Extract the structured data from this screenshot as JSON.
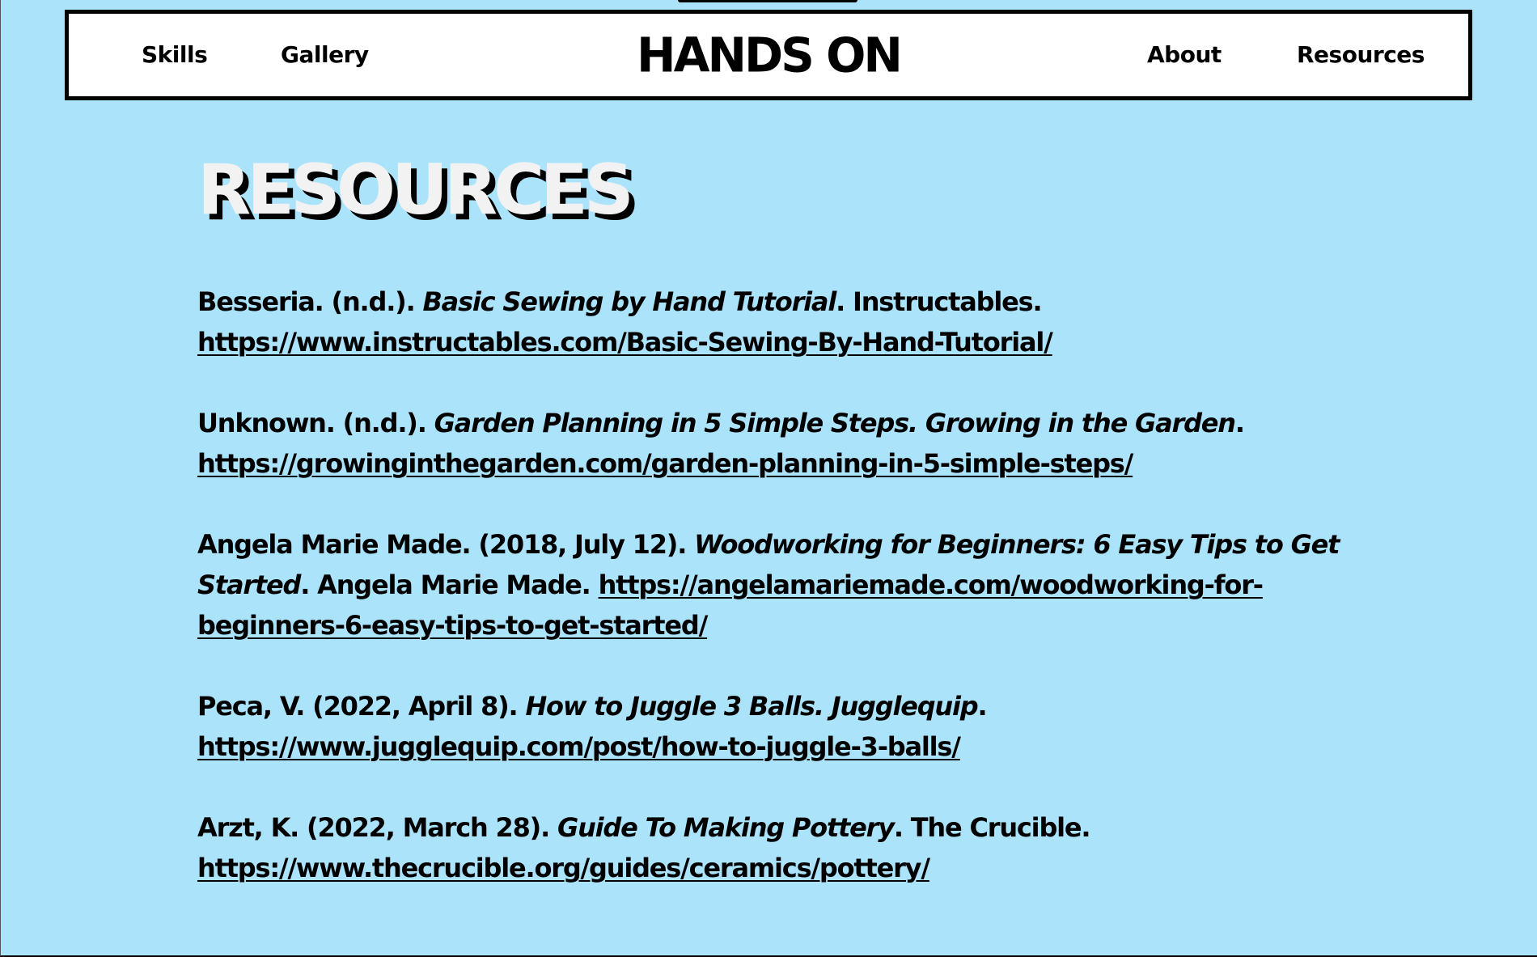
{
  "header": {
    "brand": "HANDS ON",
    "nav_left": [
      {
        "label": "Skills"
      },
      {
        "label": "Gallery"
      }
    ],
    "nav_right": [
      {
        "label": "About"
      },
      {
        "label": "Resources"
      }
    ]
  },
  "main": {
    "title": "RESOURCES",
    "references": [
      {
        "author": "Besseria. (n.d.). ",
        "title": "Basic Sewing by Hand Tutorial",
        "after_title": ". Instructables. ",
        "url": "https://www.instructables.com/Basic-Sewing-By-Hand-Tutorial/"
      },
      {
        "author": "Unknown. (n.d.). ",
        "title": "Garden Planning in 5 Simple Steps. Growing in the Garden",
        "after_title": ". ",
        "url": "https://growinginthegarden.com/garden-planning-in-5-simple-steps/"
      },
      {
        "author": "Angela Marie Made. (2018, July 12). ",
        "title": "Woodworking for Beginners: 6 Easy Tips to Get Started",
        "after_title": ". Angela Marie Made. ",
        "url": "https://angelamariemade.com/woodworking-for-beginners-6-easy-tips-to-get-started/"
      },
      {
        "author": "Peca, V. (2022, April 8). ",
        "title": "How to Juggle 3 Balls. Jugglequip",
        "after_title": ". ",
        "url": "https://www.jugglequip.com/post/how-to-juggle-3-balls/"
      },
      {
        "author": "Arzt, K. (2022, March 28). ",
        "title": "Guide To Making Pottery",
        "after_title": ". The Crucible. ",
        "url": "https://www.thecrucible.org/guides/ceramics/pottery/"
      }
    ]
  },
  "colors": {
    "background": "#abe3fa",
    "nav_background": "#ffffff",
    "text": "#000000",
    "title_fill": "#f2f2f2"
  }
}
